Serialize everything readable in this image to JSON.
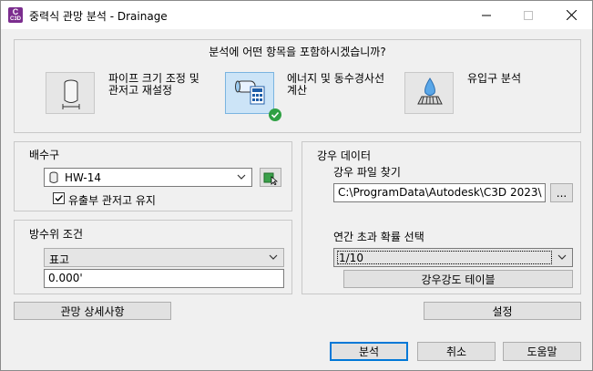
{
  "window": {
    "title": "중력식 관망 분석 - Drainage",
    "app_icon_letter": "C",
    "app_icon_sub": "C3D"
  },
  "question": "분석에 어떤 항목을 포함하시겠습니까?",
  "options": [
    {
      "label_line1": "파이프 크기 조정 및",
      "label_line2": "관저고 재설정",
      "icon": "pipe-icon",
      "selected": false
    },
    {
      "label_line1": "에너지 및 동수경사선",
      "label_line2": "계산",
      "icon": "energy-calc-icon",
      "selected": true
    },
    {
      "label_line1": "유입구 분석",
      "label_line2": "",
      "icon": "inlet-icon",
      "selected": false
    }
  ],
  "outfall": {
    "title": "배수구",
    "selected": "HW-14",
    "keep_invert_label": "유출부 관저고 유지",
    "keep_invert_checked": true
  },
  "tailwater": {
    "title": "방수위 조건",
    "condition": "표고",
    "value": "0.000'"
  },
  "rainfall": {
    "title": "강우 데이터",
    "file_label": "강우 파일 찾기",
    "file_path": "C:\\ProgramData\\Autodesk\\C3D 2023\\",
    "browse_label": "...",
    "exceedance_label": "연간 초과 확률 선택",
    "exceedance_value": "1/10",
    "idf_button": "강우강도 테이블"
  },
  "buttons": {
    "network_details": "관망 상세사항",
    "settings": "설정",
    "analyze": "분석",
    "cancel": "취소",
    "help": "도움말"
  },
  "colors": {
    "accent": "#0078d7",
    "selected_tile": "#cce4f7",
    "check_badge": "#2ea043",
    "app_icon": "#7b2d8e"
  }
}
